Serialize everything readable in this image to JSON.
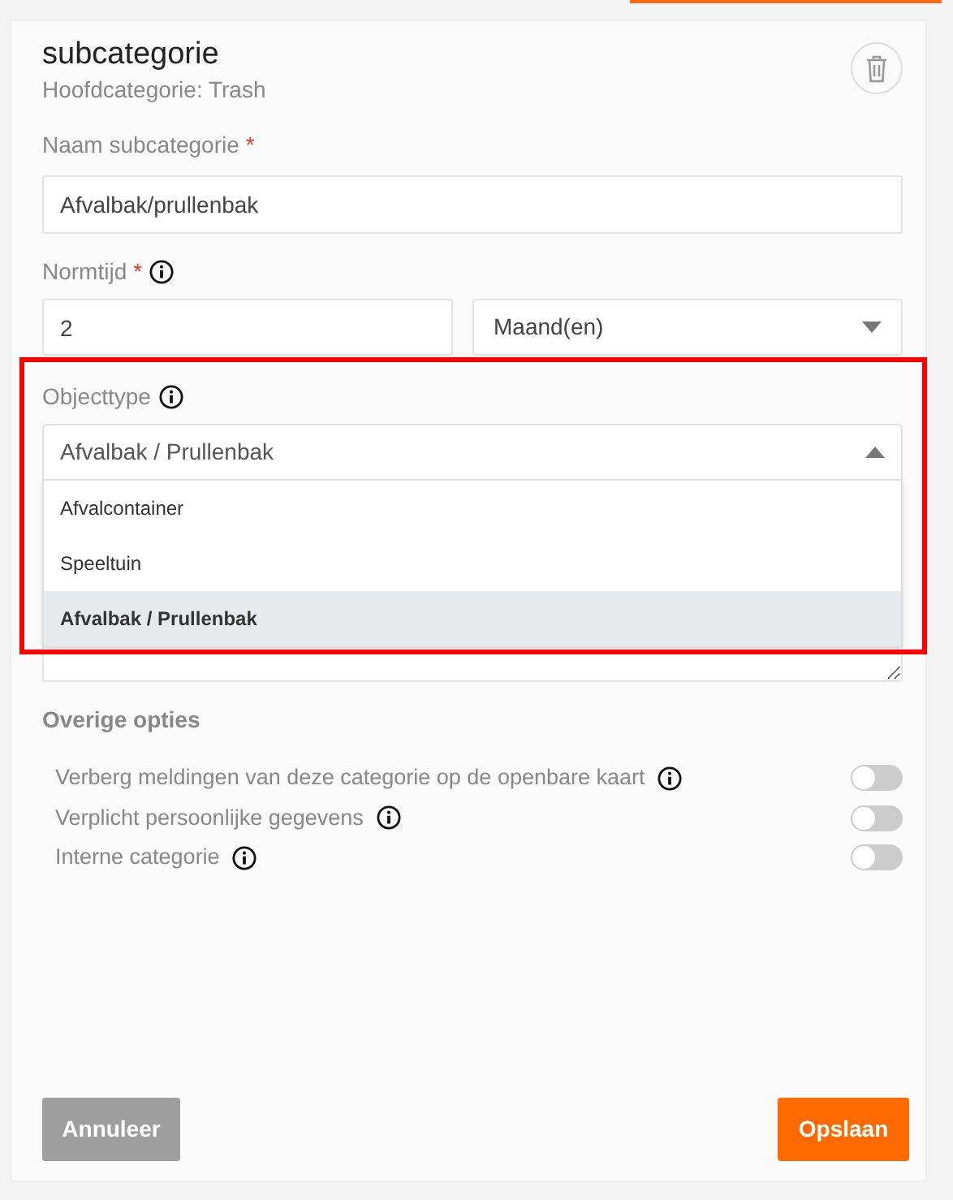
{
  "header": {
    "title": "subcategorie",
    "subtitle": "Hoofdcategorie: Trash"
  },
  "name_field": {
    "label": "Naam subcategorie",
    "required_mark": "*",
    "value": "Afvalbak/prullenbak"
  },
  "normtijd": {
    "label": "Normtijd",
    "required_mark": "*",
    "value": "2",
    "unit": "Maand(en)"
  },
  "objecttype": {
    "label": "Objecttype",
    "value": "Afvalbak / Prullenbak",
    "expanded": true,
    "options": [
      {
        "label": "Afvalcontainer",
        "selected": false
      },
      {
        "label": "Speeltuin",
        "selected": false
      },
      {
        "label": "Afvalbak / Prullenbak",
        "selected": true
      }
    ]
  },
  "other_options": {
    "title": "Overige opties",
    "toggles": [
      {
        "label": "Verberg meldingen van deze categorie op de openbare kaart",
        "on": false
      },
      {
        "label": "Verplicht persoonlijke gegevens",
        "on": false
      },
      {
        "label": "Interne categorie",
        "on": false
      }
    ]
  },
  "buttons": {
    "cancel": "Annuleer",
    "save": "Opslaan"
  }
}
